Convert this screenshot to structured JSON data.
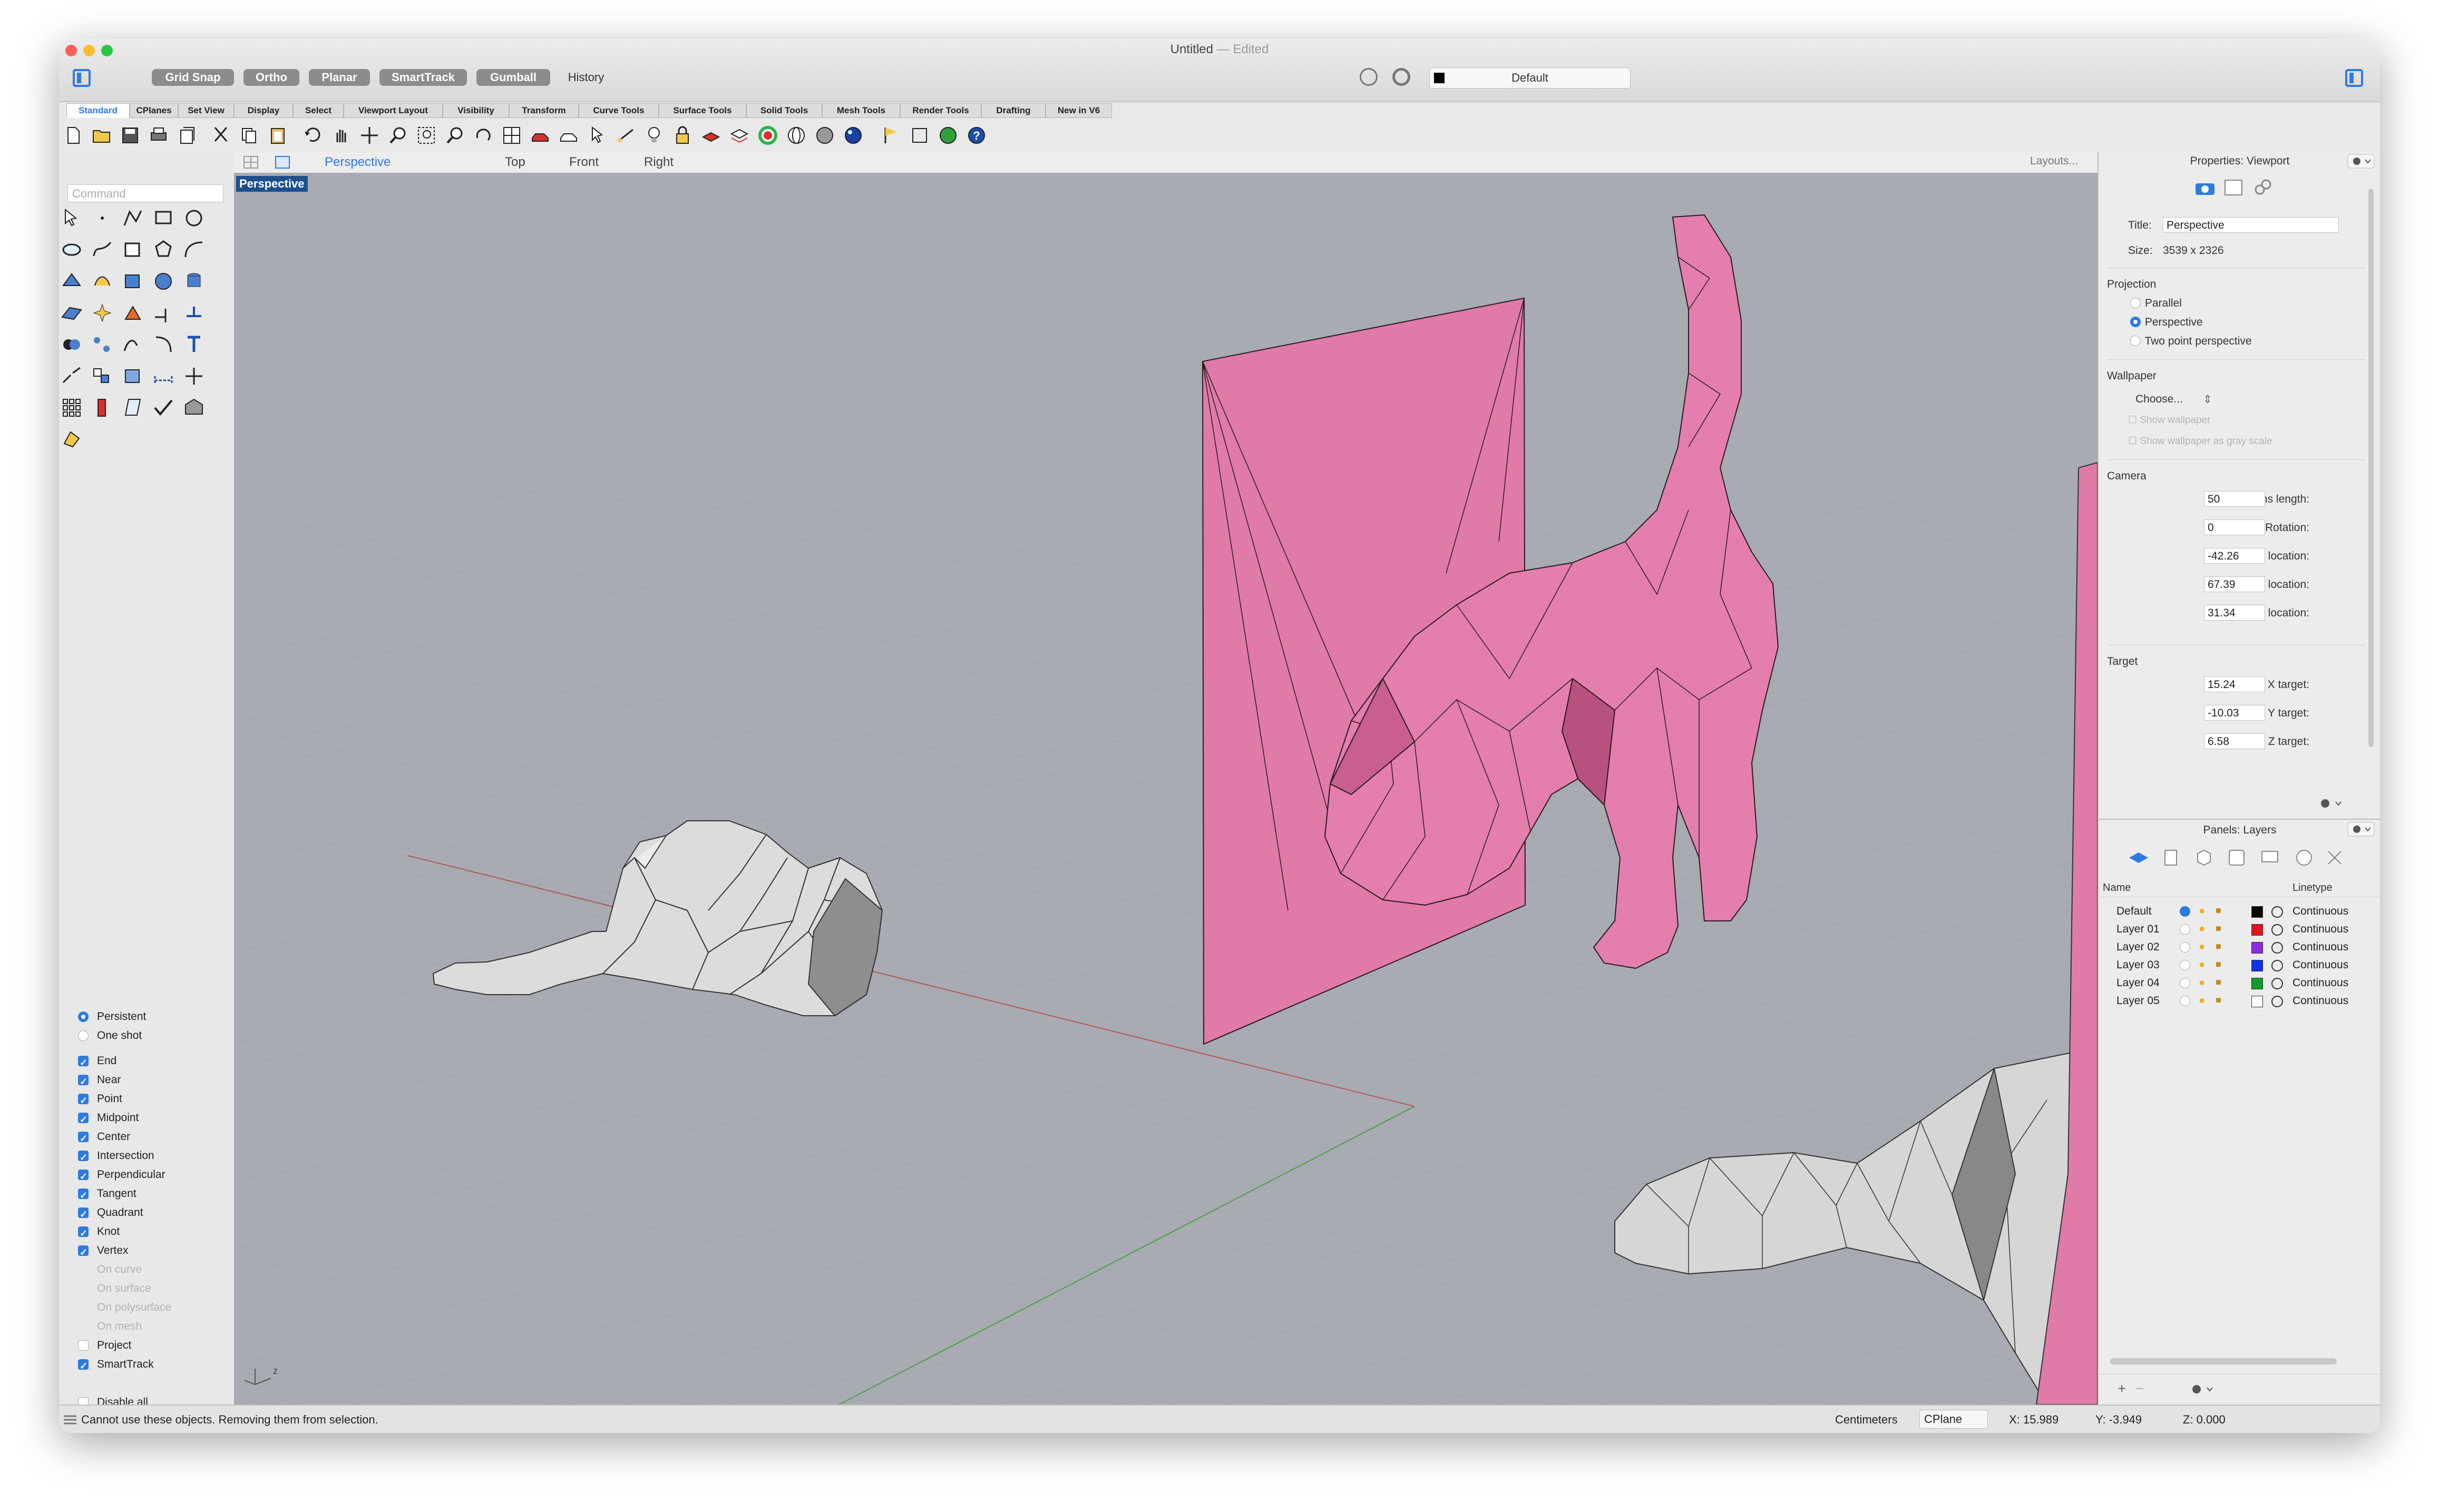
{
  "window": {
    "title": "Untitled",
    "title_suffix": "— Edited"
  },
  "topbar": {
    "buttons": [
      {
        "label": "Grid Snap",
        "on": true
      },
      {
        "label": "Ortho",
        "on": true
      },
      {
        "label": "Planar",
        "on": true
      },
      {
        "label": "SmartTrack",
        "on": true
      },
      {
        "label": "Gumball",
        "on": true
      },
      {
        "label": "History",
        "on": false
      }
    ],
    "layer_selector": "Default"
  },
  "tabs": [
    "Standard",
    "CPlanes",
    "Set View",
    "Display",
    "Select",
    "Viewport Layout",
    "Visibility",
    "Transform",
    "Curve Tools",
    "Surface Tools",
    "Solid Tools",
    "Mesh Tools",
    "Render Tools",
    "Drafting",
    "New in V6"
  ],
  "active_tab": "Standard",
  "command": {
    "placeholder": "Command"
  },
  "viewport_tabs": [
    "Perspective",
    "Top",
    "Front",
    "Right"
  ],
  "active_viewport_tab": "Perspective",
  "layouts_label": "Layouts...",
  "viewport_label": "Perspective",
  "osnap": {
    "mode": [
      {
        "label": "Persistent",
        "selected": true
      },
      {
        "label": "One shot",
        "selected": false
      }
    ],
    "items": [
      {
        "label": "End",
        "checked": true,
        "enabled": true
      },
      {
        "label": "Near",
        "checked": true,
        "enabled": true
      },
      {
        "label": "Point",
        "checked": true,
        "enabled": true
      },
      {
        "label": "Midpoint",
        "checked": true,
        "enabled": true
      },
      {
        "label": "Center",
        "checked": true,
        "enabled": true
      },
      {
        "label": "Intersection",
        "checked": true,
        "enabled": true
      },
      {
        "label": "Perpendicular",
        "checked": true,
        "enabled": true
      },
      {
        "label": "Tangent",
        "checked": true,
        "enabled": true
      },
      {
        "label": "Quadrant",
        "checked": true,
        "enabled": true
      },
      {
        "label": "Knot",
        "checked": true,
        "enabled": true
      },
      {
        "label": "Vertex",
        "checked": true,
        "enabled": true
      },
      {
        "label": "On curve",
        "checked": false,
        "enabled": false
      },
      {
        "label": "On surface",
        "checked": false,
        "enabled": false
      },
      {
        "label": "On polysurface",
        "checked": false,
        "enabled": false
      },
      {
        "label": "On mesh",
        "checked": false,
        "enabled": false
      },
      {
        "label": "Project",
        "checked": false,
        "enabled": true
      },
      {
        "label": "SmartTrack",
        "checked": true,
        "enabled": true
      }
    ],
    "disable_all": "Disable all"
  },
  "properties": {
    "header": "Properties: Viewport",
    "title_label": "Title:",
    "title_value": "Perspective",
    "size_label": "Size:",
    "size_value": "3539 x 2326",
    "projection_label": "Projection",
    "projection_options": [
      {
        "label": "Parallel",
        "selected": false
      },
      {
        "label": "Perspective",
        "selected": true
      },
      {
        "label": "Two point perspective",
        "selected": false
      }
    ],
    "wallpaper_label": "Wallpaper",
    "wallpaper_choose": "Choose...",
    "show_wallpaper": "Show wallpaper",
    "show_wallpaper_gray": "Show wallpaper as gray scale",
    "camera_label": "Camera",
    "camera_fields": [
      {
        "label": "Lens length:",
        "value": "50"
      },
      {
        "label": "Rotation:",
        "value": "0"
      },
      {
        "label": "X location:",
        "value": "-42.26"
      },
      {
        "label": "Y location:",
        "value": "67.39"
      },
      {
        "label": "Z location:",
        "value": "31.34"
      }
    ],
    "target_label": "Target",
    "target_fields": [
      {
        "label": "X target:",
        "value": "15.24"
      },
      {
        "label": "Y target:",
        "value": "-10.03"
      },
      {
        "label": "Z target:",
        "value": "6.58"
      }
    ]
  },
  "layers": {
    "header": "Panels: Layers",
    "col_name": "Name",
    "col_linetype": "Linetype",
    "rows": [
      {
        "name": "Default",
        "color": "#000000",
        "linetype": "Continuous",
        "current": true
      },
      {
        "name": "Layer 01",
        "color": "#e0141e",
        "linetype": "Continuous",
        "current": false
      },
      {
        "name": "Layer 02",
        "color": "#8b2be2",
        "linetype": "Continuous",
        "current": false
      },
      {
        "name": "Layer 03",
        "color": "#1230e6",
        "linetype": "Continuous",
        "current": false
      },
      {
        "name": "Layer 04",
        "color": "#129a2a",
        "linetype": "Continuous",
        "current": false
      },
      {
        "name": "Layer 05",
        "color": "#ffffff",
        "linetype": "Continuous",
        "current": false
      }
    ]
  },
  "status": {
    "message": "Cannot use these objects. Removing them from selection.",
    "units": "Centimeters",
    "cplane": "CPlane",
    "x": "X: 15.989",
    "y": "Y: -3.949",
    "z": "Z: 0.000"
  },
  "colors": {
    "accent": "#2e7ae0",
    "viewport_bg": "#a8abb1",
    "mesh_pink": "#e07aa8",
    "mesh_gray": "#d9d9d9"
  }
}
